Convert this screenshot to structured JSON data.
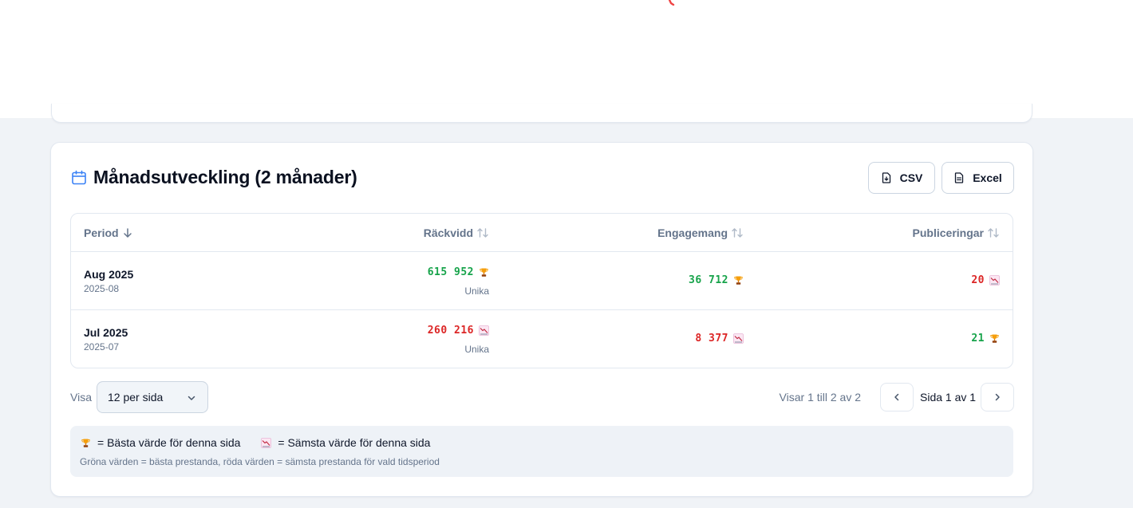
{
  "section": {
    "title": "Månadsutveckling (2 månader)",
    "csv_label": "CSV",
    "excel_label": "Excel"
  },
  "table": {
    "columns": [
      "Period",
      "Räckvidd",
      "Engagemang",
      "Publiceringar"
    ],
    "rows": [
      {
        "period": "Aug 2025",
        "code": "2025-08",
        "reach": "615 952",
        "reach_sub": "Unika",
        "reach_mark": "trophy-icon",
        "engagement": "36 712",
        "engagement_mark": "trophy-icon",
        "publications": "20",
        "publications_mark": "chart-down-icon"
      },
      {
        "period": "Jul 2025",
        "code": "2025-07",
        "reach": "260 216",
        "reach_sub": "Unika",
        "reach_mark": "chart-down-icon",
        "engagement": "8 377",
        "engagement_mark": "chart-down-icon",
        "publications": "21",
        "publications_mark": "trophy-icon"
      }
    ]
  },
  "pagination": {
    "show_label": "Visa",
    "per_page": "12 per sida",
    "showing": "Visar 1 till 2 av 2",
    "page_info": "Sida 1 av 1"
  },
  "legend": {
    "best": "= Bästa värde för denna sida",
    "worst": "= Sämsta värde för denna sida",
    "note": "Gröna värden = bästa prestanda, röda värden = sämsta prestanda för vald tidsperiod"
  },
  "colors": {
    "best": "#16a34a",
    "worst": "#dc2626",
    "accent": "#3b82f6"
  }
}
